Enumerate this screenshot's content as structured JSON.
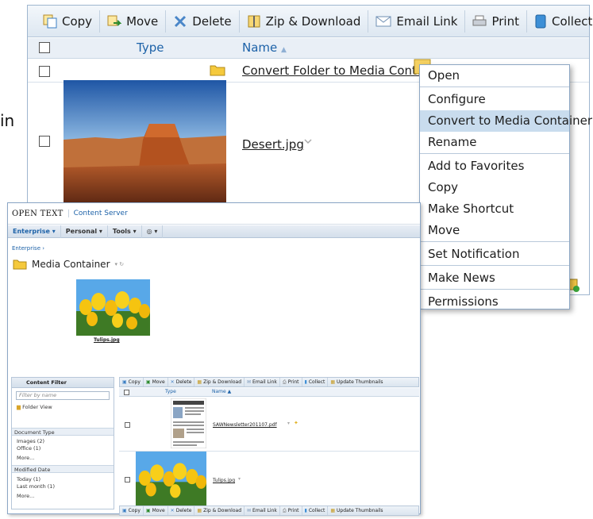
{
  "left_fragment": "in",
  "back_window": {
    "toolbar": [
      {
        "icon": "copy-icon",
        "label": "Copy"
      },
      {
        "icon": "move-icon",
        "label": "Move"
      },
      {
        "icon": "delete-icon",
        "label": "Delete"
      },
      {
        "icon": "zip-icon",
        "label": "Zip & Download"
      },
      {
        "icon": "email-icon",
        "label": "Email Link"
      },
      {
        "icon": "print-icon",
        "label": "Print"
      },
      {
        "icon": "collect-icon",
        "label": "Collect"
      }
    ],
    "header": {
      "type_label": "Type",
      "name_label": "Name",
      "sort_indicator": "▲"
    },
    "rows": [
      {
        "name": "Convert Folder to Media Container",
        "icon": "folder-icon"
      },
      {
        "name": "Desert.jpg",
        "icon": "desert-thumbnail"
      }
    ]
  },
  "context_menu": {
    "groups": [
      [
        "Open"
      ],
      [
        "Configure",
        "Convert to Media Container",
        "Rename"
      ],
      [
        "Add to Favorites",
        "Copy",
        "Make Shortcut",
        "Move"
      ],
      [
        "Set Notification"
      ],
      [
        "Make News"
      ],
      [
        "Permissions"
      ]
    ],
    "highlighted": "Convert to Media Container"
  },
  "front_window": {
    "brand": "OPEN TEXT",
    "product": "Content Server",
    "nav": [
      "Enterprise",
      "Personal",
      "Tools"
    ],
    "breadcrumb": "Enterprise",
    "title": "Media Container",
    "featured_caption": "Tulips.jpg",
    "filter": {
      "title": "Content Filter",
      "search_placeholder": "Filter by name",
      "folder_view": "Folder View",
      "sections": [
        {
          "title": "Document Type",
          "items": [
            "Images (2)",
            "Office (1)",
            "More..."
          ]
        },
        {
          "title": "Modified Date",
          "items": [
            "Today (1)",
            "Last month (1)",
            "More..."
          ]
        }
      ]
    },
    "toolbar": [
      "Copy",
      "Move",
      "Delete",
      "Zip & Download",
      "Email Link",
      "Print",
      "Collect",
      "Update Thumbnails"
    ],
    "header": {
      "type_label": "Type",
      "name_label": "Name ▲"
    },
    "rows": [
      {
        "name": "SAWNewsletter201107.pdf"
      },
      {
        "name": "Tulips.jpg"
      }
    ]
  }
}
